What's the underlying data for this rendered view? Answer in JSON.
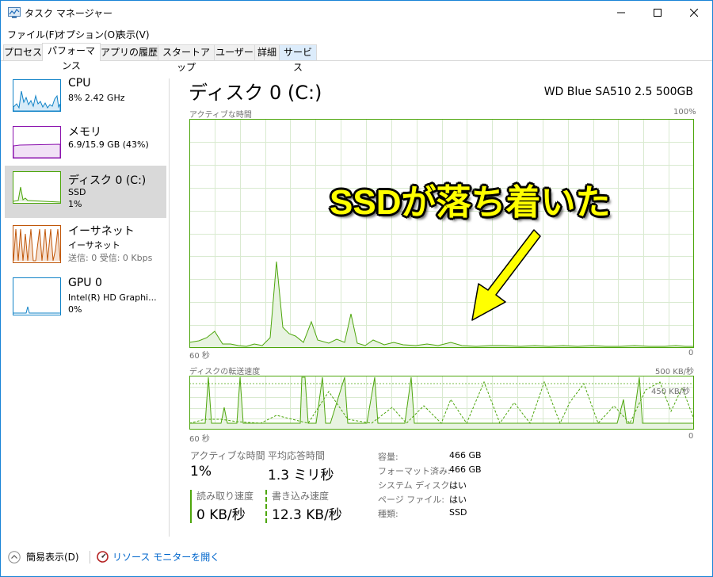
{
  "window": {
    "title": "タスク マネージャー"
  },
  "menu": [
    "ファイル(F)",
    "オプション(O)",
    "表示(V)"
  ],
  "tabs": [
    "プロセス",
    "パフォーマンス",
    "アプリの履歴",
    "スタートアップ",
    "ユーザー",
    "詳細",
    "サービス"
  ],
  "sidebar": {
    "items": [
      {
        "name": "CPU",
        "line1": "8%  2.42 GHz",
        "line2": ""
      },
      {
        "name": "メモリ",
        "line1": "6.9/15.9 GB (43%)",
        "line2": ""
      },
      {
        "name": "ディスク 0 (C:)",
        "line1": "SSD",
        "line2": "1%"
      },
      {
        "name": "イーサネット",
        "line1": "イーサネット",
        "line2": "送信: 0  受信: 0 Kbps"
      },
      {
        "name": "GPU 0",
        "line1": "Intel(R) HD Graphi...",
        "line2": "0%"
      }
    ]
  },
  "detail": {
    "title": "ディスク 0 (C:)",
    "model": "WD Blue SA510 2.5 500GB",
    "graph1": {
      "label": "アクティブな時間",
      "max": "100%",
      "time": "60 秒",
      "min": "0"
    },
    "graph2": {
      "label": "ディスクの転送速度",
      "max": "500 KB/秒",
      "second": "450 KB/秒",
      "time": "60 秒",
      "min": "0"
    },
    "stats": {
      "active_label": "アクティブな時間",
      "active_value": "1%",
      "resp_label": "平均応答時間",
      "resp_value": "1.3 ミリ秒",
      "read_label": "読み取り速度",
      "read_value": "0 KB/秒",
      "write_label": "書き込み速度",
      "write_value": "12.3 KB/秒"
    },
    "props": [
      {
        "key": "容量:",
        "value": "466 GB"
      },
      {
        "key": "フォーマット済み:",
        "value": "466 GB"
      },
      {
        "key": "システム ディスク:",
        "value": "はい"
      },
      {
        "key": "ページ ファイル:",
        "value": "はい"
      },
      {
        "key": "種類:",
        "value": "SSD"
      }
    ]
  },
  "footer": {
    "summary": "簡易表示(D)",
    "monitor": "リソース モニターを開く"
  },
  "annotation": "SSDが落ち着いた",
  "colors": {
    "disk": "#4da60c",
    "cpu": "#1183c7",
    "mem": "#8b12ae",
    "net": "#c0570a",
    "accent": "#1883d7"
  }
}
